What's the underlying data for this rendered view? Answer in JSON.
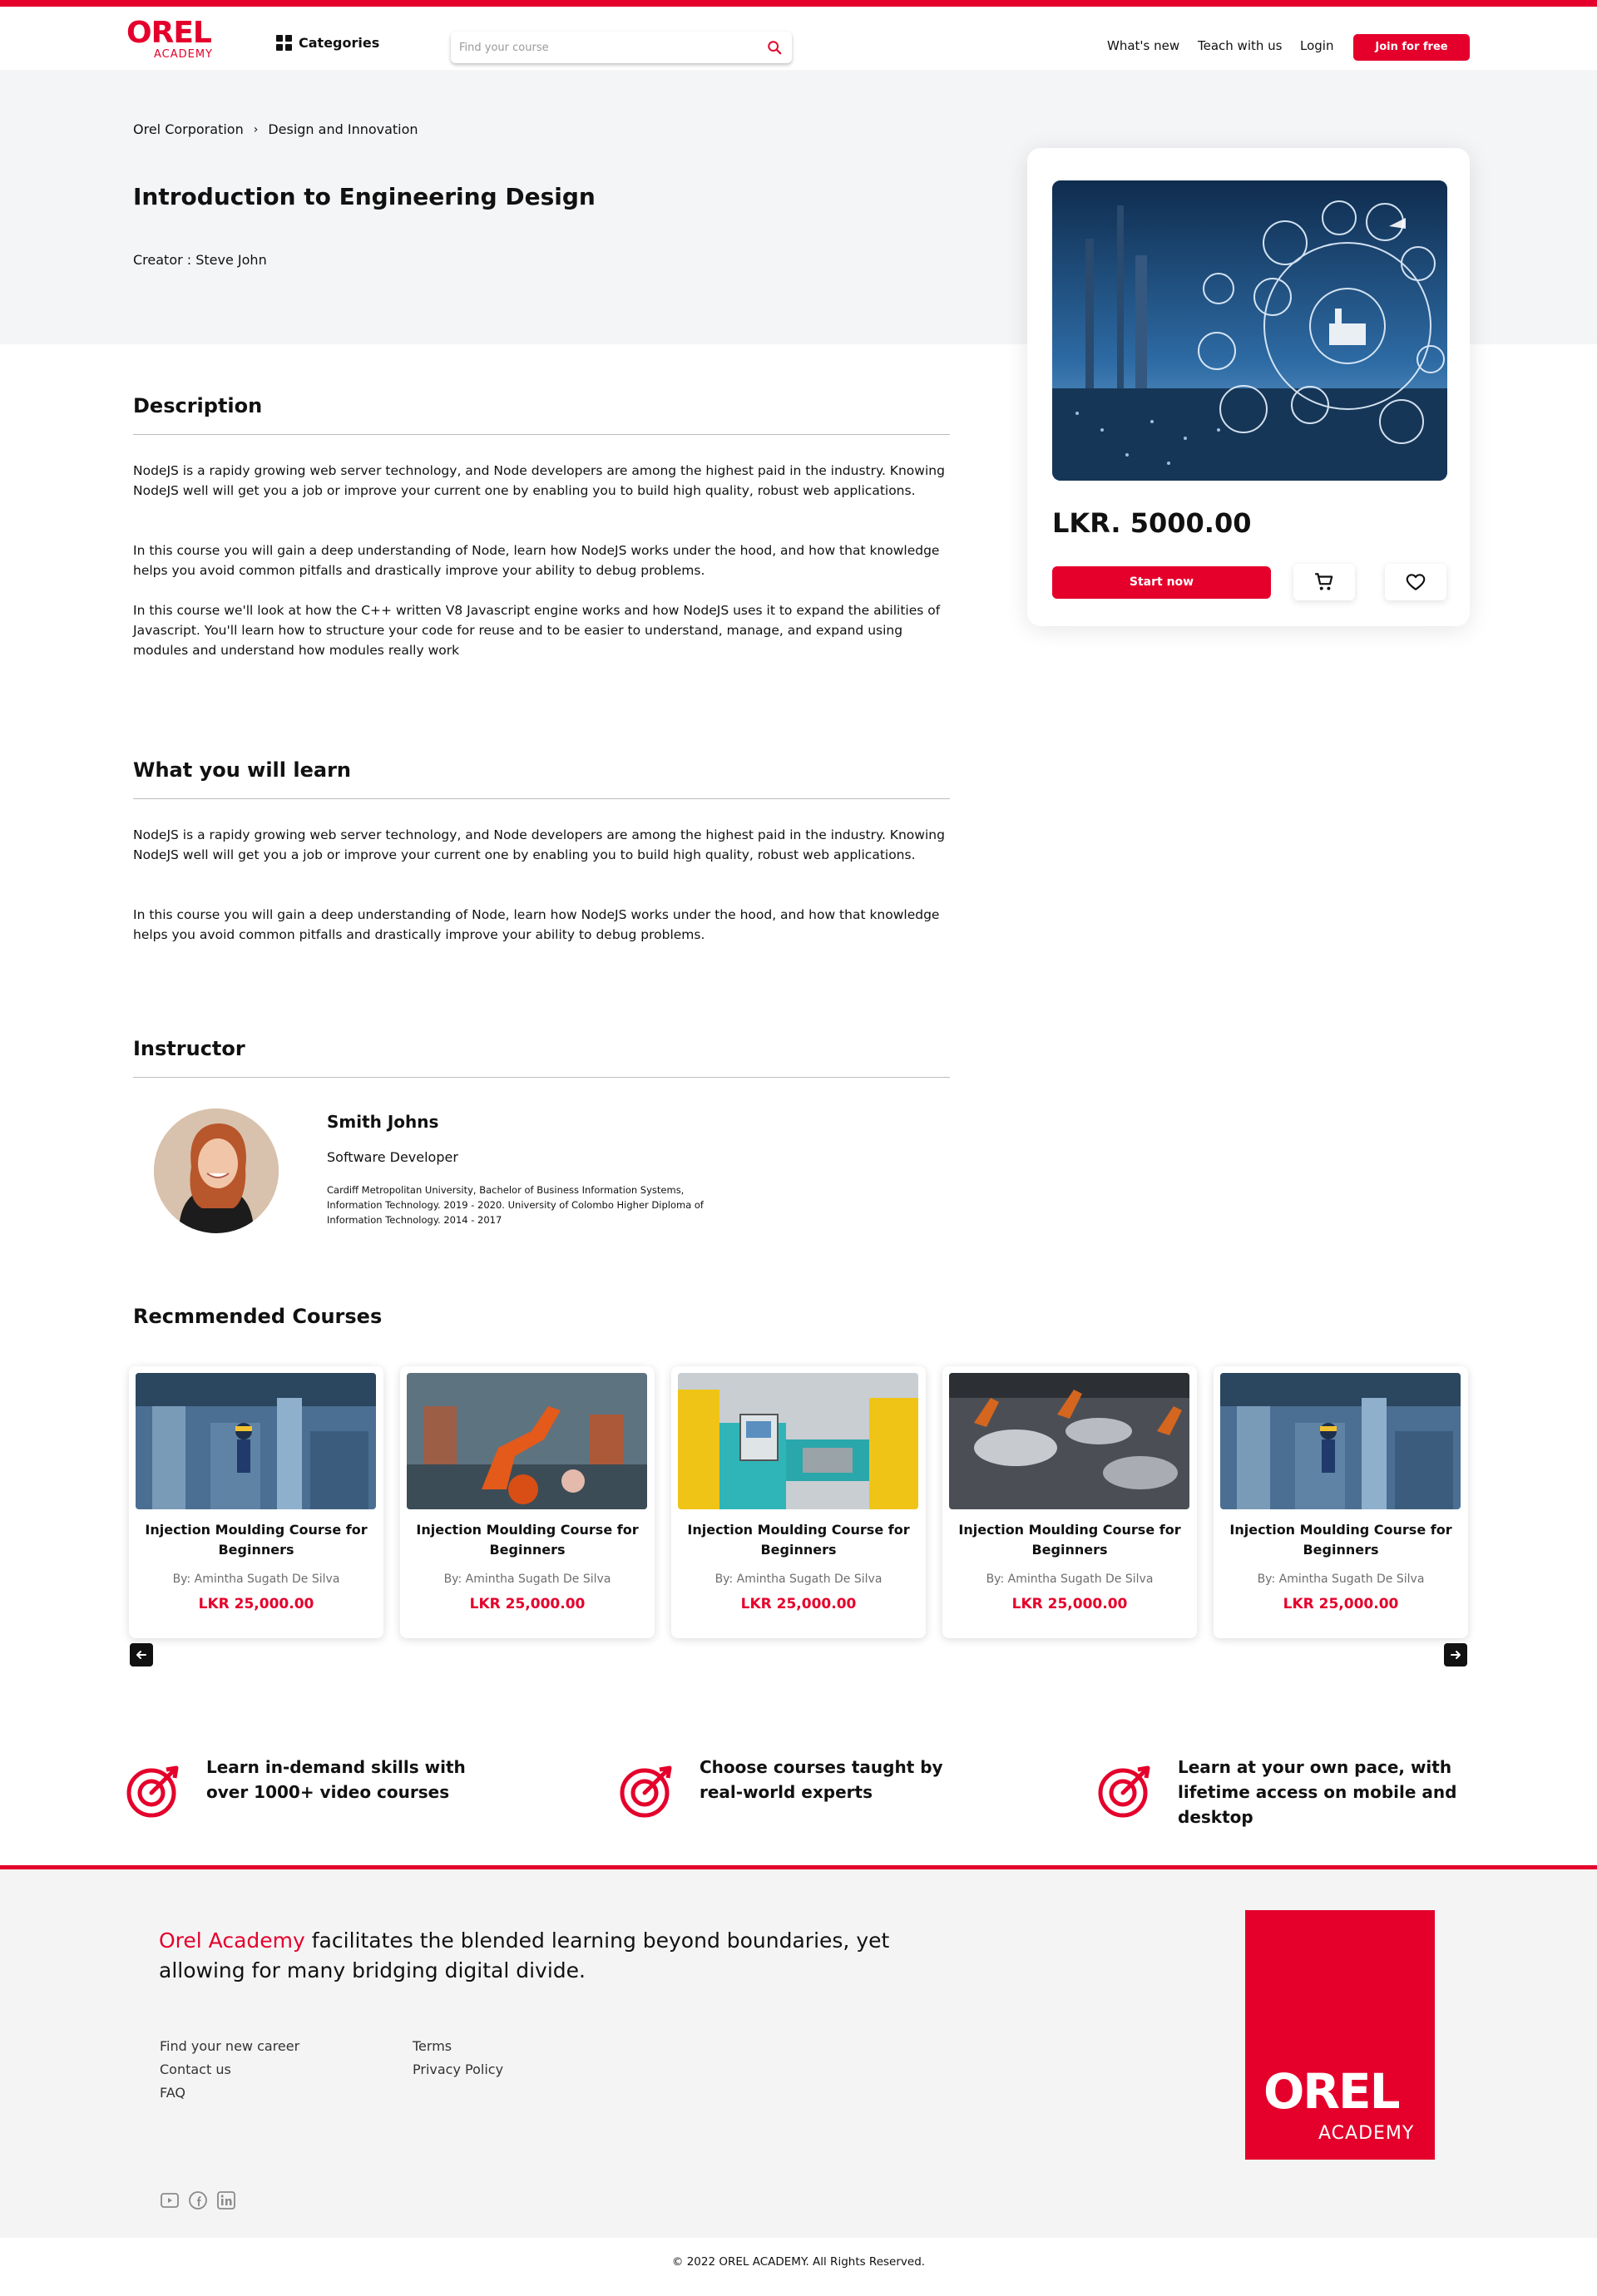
{
  "colors": {
    "accent": "#e4002b",
    "hero_bg": "#f4f5f7",
    "footer_bg": "#f4f4f5"
  },
  "nav": {
    "logo_mark": "OREL",
    "logo_sub": "ACADEMY",
    "categories_label": "Categories",
    "search_placeholder": "Find your course",
    "links": [
      "What's new",
      "Teach with us",
      "Login"
    ],
    "join_label": "Join for free"
  },
  "breadcrumb": [
    "Orel Corporation",
    "Design and Innovation"
  ],
  "course": {
    "title": "Introduction to Engineering Design",
    "creator": "Creator : Steve John",
    "price": "LKR. 5000.00",
    "start_label": "Start now",
    "cart_icon": "cart-icon",
    "wishlist_icon": "heart-icon"
  },
  "description": {
    "heading": "Description",
    "paragraphs": [
      "NodeJS is a rapidy growing web server technology, and Node developers are among the highest paid in the industry. Knowing NodeJS well will get you a job or improve your current one by enabling you to build high quality, robust web applications.",
      "In this course you will gain a deep understanding of Node, learn how NodeJS works under the hood, and how that knowledge helps you avoid common pitfalls and drastically improve your ability to debug problems.",
      "In this course we'll look at how the C++ written V8 Javascript engine works and how NodeJS uses it to expand the abilities of Javascript. You'll learn how to structure your code for reuse and to be easier to understand, manage, and expand using modules and understand how modules really work"
    ]
  },
  "learn": {
    "heading": "What you will learn",
    "paragraphs": [
      "NodeJS is a rapidy growing web server technology, and Node developers are among the highest paid in the industry. Knowing NodeJS well will get you a job or improve your current one by enabling you to build high quality, robust web applications.",
      "In this course you will gain a deep understanding of Node, learn how NodeJS works under the hood, and how that knowledge helps you avoid common pitfalls and drastically improve your ability to debug problems."
    ]
  },
  "instructor": {
    "heading": "Instructor",
    "name": "Smith Johns",
    "role": "Software Developer",
    "bio": "Cardiff Metropolitan University, Bachelor of Business Information Systems, Information Technology. 2019 - 2020. University of Colombo Higher Diploma of Information Technology. 2014 - 2017"
  },
  "recommended": {
    "heading": "Recmmended Courses",
    "courses": [
      {
        "title": "Injection Moulding Course for Beginners",
        "by": "By: Amintha Sugath De Silva",
        "price": "LKR 25,000.00"
      },
      {
        "title": "Injection Moulding Course for Beginners",
        "by": "By: Amintha Sugath De Silva",
        "price": "LKR 25,000.00"
      },
      {
        "title": "Injection Moulding Course for Beginners",
        "by": "By: Amintha Sugath De Silva",
        "price": "LKR 25,000.00"
      },
      {
        "title": "Injection Moulding Course for Beginners",
        "by": "By: Amintha Sugath De Silva",
        "price": "LKR 25,000.00"
      },
      {
        "title": "Injection Moulding Course for Beginners",
        "by": "By: Amintha Sugath De Silva",
        "price": "LKR 25,000.00"
      }
    ]
  },
  "features": [
    "Learn in-demand skills with over 1000+ video courses",
    "Choose courses taught by real-world experts",
    "Learn at your own pace, with lifetime access on mobile and desktop"
  ],
  "footer": {
    "brand": "Orel Academy",
    "tagline_rest": " facilitates the blended learning beyond boundaries, yet allowing for many bridging digital divide.",
    "links_col1": [
      "Find your new career",
      "Contact us",
      "FAQ"
    ],
    "links_col2": [
      "Terms",
      "Privacy Policy"
    ],
    "logo_mark": "OREL",
    "logo_sub": "ACADEMY",
    "social_icons": [
      "youtube-icon",
      "facebook-icon",
      "linkedin-icon"
    ],
    "copyright": "© 2022 OREL ACADEMY. All Rights Reserved."
  }
}
